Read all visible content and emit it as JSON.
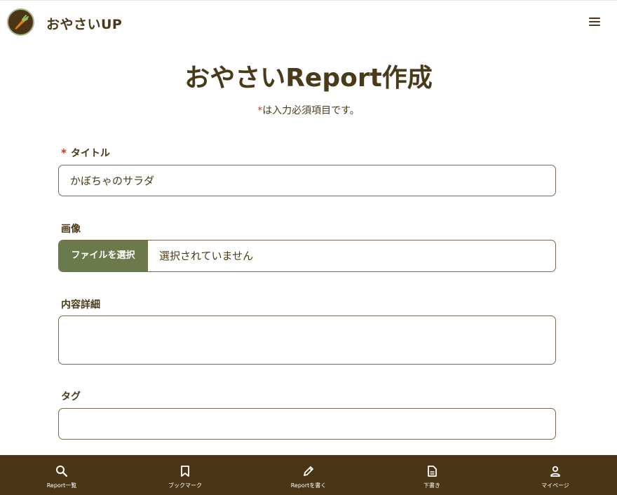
{
  "header": {
    "brand": "おやさいUP",
    "logo_icon": "carrot-logo-icon",
    "menu_icon": "hamburger-menu-icon"
  },
  "page": {
    "title": "おやさいReport作成",
    "required_mark": "*",
    "required_note": "は入力必須項目です。"
  },
  "form": {
    "title_field": {
      "required_mark": "*",
      "label": "タイトル",
      "value": "かぼちゃのサラダ"
    },
    "image_field": {
      "label": "画像",
      "button_label": "ファイルを選択",
      "status": "選択されていません"
    },
    "content_field": {
      "label": "内容詳細",
      "value": ""
    },
    "tag_field": {
      "label": "タグ",
      "value": ""
    }
  },
  "bottom_nav": {
    "items": [
      {
        "label": "Report一覧",
        "icon": "search-icon"
      },
      {
        "label": "ブックマーク",
        "icon": "bookmark-icon"
      },
      {
        "label": "Reportを書く",
        "icon": "pencil-icon"
      },
      {
        "label": "下書き",
        "icon": "document-icon"
      },
      {
        "label": "マイページ",
        "icon": "person-icon"
      }
    ]
  },
  "colors": {
    "brand_brown": "#4a3616",
    "text_brown": "#4a3a1a",
    "file_button_green": "#6b7a4b",
    "required_red": "#c0392b"
  }
}
